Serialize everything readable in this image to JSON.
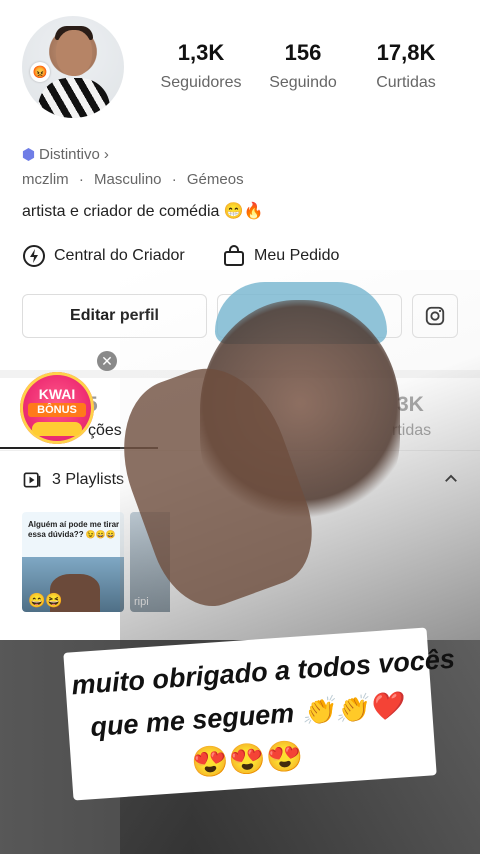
{
  "profile": {
    "avatar_badge": "😡",
    "stats": [
      {
        "value": "1,3K",
        "label": "Seguidores"
      },
      {
        "value": "156",
        "label": "Seguindo"
      },
      {
        "value": "17,8K",
        "label": "Curtidas"
      }
    ],
    "badge_label": "Distintivo",
    "badge_chevron": "›",
    "username": "mczlim",
    "gender": "Masculino",
    "sign": "Gémeos",
    "dot": "·",
    "bio": "artista e criador de comédia 😁🔥"
  },
  "links": {
    "creator_center": "Central do Criador",
    "my_order": "Meu Pedido"
  },
  "actions": {
    "edit_profile": "Editar perfil"
  },
  "tabs": {
    "tab1_count": "5",
    "tab1_label": "ções",
    "tab3_count": "3K",
    "tab3_label": "rtidas"
  },
  "playlists": {
    "label": "3 Playlists",
    "thumb_caption": "Alguém aí pode me tirar essa dúvida?? 😉😄😄",
    "thumb_emoji": "😄😆",
    "thumb2_caption": "ripi"
  },
  "promo": {
    "close": "✕",
    "title": "KWAI",
    "subtitle": "BÔNUS"
  },
  "video": {
    "caption_line1": "muito obrigado a todos vocês",
    "caption_line2": "que me seguem 👏👏❤️",
    "caption_line3": "😍😍😍"
  },
  "colors": {
    "badge_icon": "#6f7de6",
    "kwai_pink": "#ef2f74"
  }
}
